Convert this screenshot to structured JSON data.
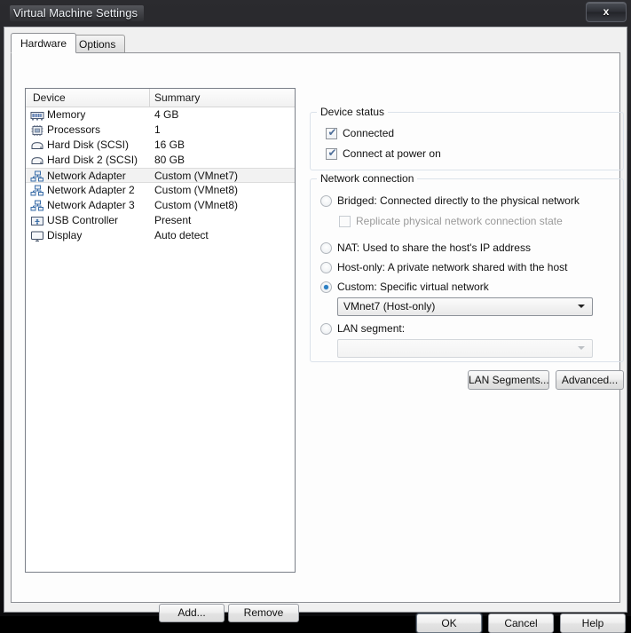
{
  "window": {
    "title": "Virtual Machine Settings",
    "close_label": "x",
    "close_icon": "close-icon"
  },
  "tabs": [
    {
      "label": "Hardware",
      "active": true
    },
    {
      "label": "Options",
      "active": false
    }
  ],
  "device_list": {
    "columns": [
      "Device",
      "Summary"
    ],
    "rows": [
      {
        "icon": "memory-icon",
        "name": "Memory",
        "summary": "4 GB",
        "selected": false
      },
      {
        "icon": "cpu-icon",
        "name": "Processors",
        "summary": "1",
        "selected": false
      },
      {
        "icon": "harddisk-icon",
        "name": "Hard Disk (SCSI)",
        "summary": "16 GB",
        "selected": false
      },
      {
        "icon": "harddisk-icon",
        "name": "Hard Disk 2 (SCSI)",
        "summary": "80 GB",
        "selected": false
      },
      {
        "icon": "network-icon",
        "name": "Network Adapter",
        "summary": "Custom (VMnet7)",
        "selected": true
      },
      {
        "icon": "network-icon",
        "name": "Network Adapter 2",
        "summary": "Custom (VMnet8)",
        "selected": false
      },
      {
        "icon": "network-icon",
        "name": "Network Adapter 3",
        "summary": "Custom (VMnet8)",
        "selected": false
      },
      {
        "icon": "usb-icon",
        "name": "USB Controller",
        "summary": "Present",
        "selected": false
      },
      {
        "icon": "display-icon",
        "name": "Display",
        "summary": "Auto detect",
        "selected": false
      }
    ]
  },
  "list_buttons": {
    "add": "Add...",
    "remove": "Remove"
  },
  "device_status": {
    "title": "Device status",
    "connected": {
      "label": "Connected",
      "checked": true,
      "enabled": true
    },
    "connect_at_power_on": {
      "label": "Connect at power on",
      "checked": true,
      "enabled": true
    }
  },
  "network_connection": {
    "title": "Network connection",
    "options": [
      {
        "label": "Bridged: Connected directly to the physical network",
        "selected": false
      },
      {
        "label": "NAT: Used to share the host's IP address",
        "selected": false
      },
      {
        "label": "Host-only: A private network shared with the host",
        "selected": false
      },
      {
        "label": "Custom: Specific virtual network",
        "selected": true
      },
      {
        "label": "LAN segment:",
        "selected": false
      }
    ],
    "replicate": {
      "label": "Replicate physical network connection state",
      "checked": false,
      "enabled": false
    },
    "custom_network": {
      "value": "VMnet7 (Host-only)",
      "enabled": true
    },
    "lan_segment": {
      "value": "",
      "enabled": false
    },
    "lan_segments_button": "LAN Segments...",
    "advanced_button": "Advanced..."
  },
  "footer": {
    "ok": "OK",
    "cancel": "Cancel",
    "help": "Help"
  },
  "colors": {
    "accent": "#2b7fc4",
    "checkmark": "#4f6f9a",
    "group_border": "#dbe2ea",
    "panel_bg": "#fdfdfd",
    "titlebar": "#121214"
  }
}
